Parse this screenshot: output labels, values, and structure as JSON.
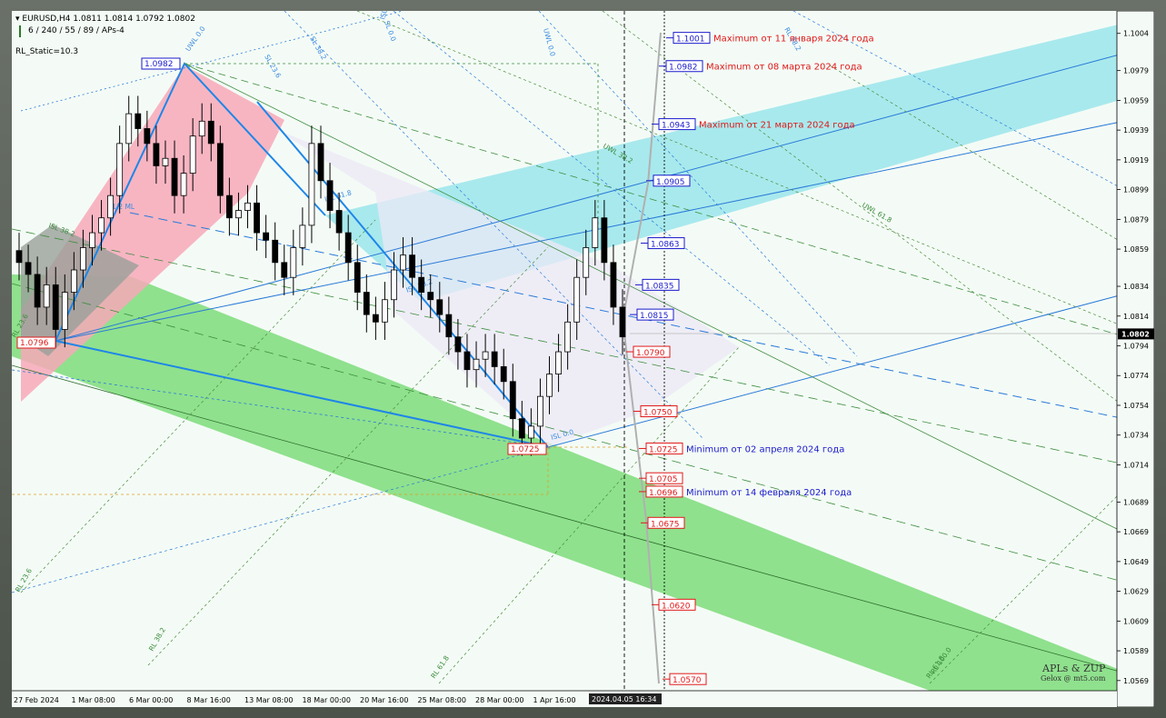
{
  "header": {
    "symbol_line": "EURUSD,H4  1.0811 1.0814 1.0792 1.0802",
    "indicator_line": "6 / 240 / 55 / 89 / APs-4",
    "static_line": "RL_Static=10.3"
  },
  "colors": {
    "background": "#f4fbf6",
    "bull_candle": "#ffffff",
    "bear_candle": "#000000",
    "green_channel": "#7ddc7a",
    "cyan_channel": "#8fe3ea",
    "pink_channel": "#f7a8b8",
    "lavender_area": "#ece8f6",
    "red_text": "#e01818",
    "blue_text": "#1a1acc"
  },
  "chart_data": {
    "type": "candlestick",
    "title": "EURUSD,H4",
    "ylim": [
      1.0564,
      1.1013
    ],
    "y_ticks": [
      "1.1004",
      "1.0979",
      "1.0959",
      "1.0939",
      "1.0919",
      "1.0899",
      "1.0879",
      "1.0859",
      "1.0834",
      "1.0814",
      "1.0794",
      "1.0774",
      "1.0754",
      "1.0734",
      "1.0714",
      "1.0689",
      "1.0669",
      "1.0649",
      "1.0629",
      "1.0609",
      "1.0589",
      "1.0569"
    ],
    "current_price": "1.0802",
    "x_labels": [
      "27 Feb 2024",
      "1 Mar 08:00",
      "6 Mar 00:00",
      "8 Mar 16:00",
      "13 Mar 08:00",
      "18 Mar 00:00",
      "20 Mar 16:00",
      "25 Mar 08:00",
      "28 Mar 00:00",
      "1 Apr 16:00"
    ],
    "cursor_time": "2024.04.05 16:34",
    "candles_close_approx": [
      1.085,
      1.0842,
      1.082,
      1.0835,
      1.0805,
      1.083,
      1.0845,
      1.086,
      1.087,
      1.088,
      1.0895,
      1.093,
      1.095,
      1.094,
      1.093,
      1.0915,
      1.092,
      1.0895,
      1.091,
      1.0935,
      1.0945,
      1.093,
      1.0895,
      1.088,
      1.0885,
      1.089,
      1.087,
      1.0865,
      1.085,
      1.084,
      1.086,
      1.0875,
      1.093,
      1.0905,
      1.0885,
      1.087,
      1.085,
      1.083,
      1.0815,
      1.081,
      1.0825,
      1.0845,
      1.0855,
      1.084,
      1.083,
      1.0825,
      1.0815,
      1.08,
      1.079,
      1.0778,
      1.0785,
      1.079,
      1.078,
      1.077,
      1.0745,
      1.0732,
      1.074,
      1.076,
      1.0775,
      1.079,
      1.081,
      1.084,
      1.086,
      1.088,
      1.085,
      1.082,
      1.08
    ],
    "price_boxes": [
      {
        "value": "1.1001",
        "note": "Maximum от 11 января 2024 года",
        "color": "blue"
      },
      {
        "value": "1.0982",
        "note": "Maximum от 08 марта 2024 года",
        "color": "blue"
      },
      {
        "value": "1.0943",
        "note": "Maximum от 21 марта 2024 года",
        "color": "blue"
      },
      {
        "value": "1.0905",
        "note": "",
        "color": "blue"
      },
      {
        "value": "1.0863",
        "note": "",
        "color": "blue"
      },
      {
        "value": "1.0835",
        "note": "",
        "color": "blue"
      },
      {
        "value": "1.0815",
        "note": "",
        "color": "blue"
      },
      {
        "value": "1.0790",
        "note": "",
        "color": "red"
      },
      {
        "value": "1.0750",
        "note": "",
        "color": "red"
      },
      {
        "value": "1.0725",
        "note": "Minimum от 02 апреля 2024 года",
        "color": "red"
      },
      {
        "value": "1.0705",
        "note": "",
        "color": "red"
      },
      {
        "value": "1.0696",
        "note": "Minimum от 14 февраля 2024 года",
        "color": "red"
      },
      {
        "value": "1.0675",
        "note": "",
        "color": "red"
      },
      {
        "value": "1.0620",
        "note": "",
        "color": "red"
      },
      {
        "value": "1.0570",
        "note": "",
        "color": "red"
      }
    ],
    "pivot_labels": [
      {
        "value": "1.0982",
        "color": "blue"
      },
      {
        "value": "1.0796",
        "color": "red"
      },
      {
        "value": "1.0725",
        "color": "red"
      }
    ],
    "level_labels": [
      "UWL 0.0",
      "RL 23.6",
      "RL 38.2",
      "ISL 61.8",
      "SL 0.0",
      "RL 61.8",
      "ISL 61.8",
      "1/2 ML",
      "ISL 38.2",
      "SL 23.6",
      "UWL 38.2",
      "UWL 61.8",
      "ISL 38.2",
      "SL 38.2",
      "UWL 0.0",
      "RL 23.6",
      "RL 38.2",
      "RL 61.8",
      "RL 100.0",
      "ISL 0.0"
    ]
  },
  "watermark": {
    "line1": "APLs & ZUP",
    "line2": "Gelox @ mt5.com"
  }
}
